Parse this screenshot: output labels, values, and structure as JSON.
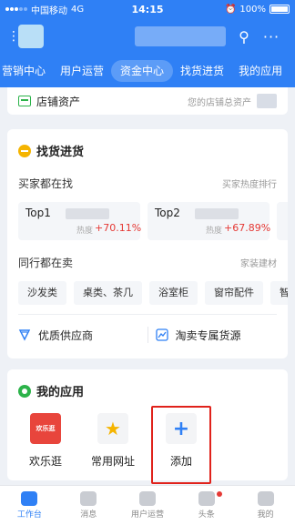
{
  "status_bar": {
    "carrier": "中国移动",
    "network": "4G",
    "time": "14:15",
    "battery": "100%"
  },
  "header": {
    "search_icon": "search-icon",
    "more_icon": "more-icon"
  },
  "nav_tabs": [
    {
      "label": "营销中心",
      "active": false
    },
    {
      "label": "用户运营",
      "active": false
    },
    {
      "label": "资金中心",
      "active": true
    },
    {
      "label": "找货进货",
      "active": false
    },
    {
      "label": "我的应用",
      "active": false
    }
  ],
  "asset_row": {
    "label": "店铺资产",
    "sub": "您的店铺总资产"
  },
  "sourcing": {
    "title": "找货进货",
    "buyers_title": "买家都在找",
    "buyers_link": "买家热度排行",
    "top_items": [
      {
        "rank": "Top1",
        "heat_label": "热度",
        "rate": "+70.11%"
      },
      {
        "rank": "Top2",
        "heat_label": "热度",
        "rate": "+67.89%"
      }
    ],
    "peers_title": "同行都在卖",
    "peers_link": "家装建材",
    "chips": [
      "沙发类",
      "桌类、茶几",
      "浴室柜",
      "窗帘配件",
      "智"
    ],
    "supply_links": [
      "优质供应商",
      "淘卖专属货源"
    ]
  },
  "my_apps": {
    "title": "我的应用",
    "apps": [
      {
        "label": "欢乐逛",
        "tile_text": "欢乐逛"
      },
      {
        "label": "常用网址",
        "tile_text": "★"
      },
      {
        "label": "添加",
        "tile_text": "+"
      }
    ]
  },
  "tab_bar": [
    {
      "label": "工作台",
      "active": true
    },
    {
      "label": "消息",
      "active": false
    },
    {
      "label": "用户运营",
      "active": false
    },
    {
      "label": "头条",
      "active": false
    },
    {
      "label": "我的",
      "active": false
    }
  ],
  "colors": {
    "brand_blue": "#2f80f5",
    "accent_red": "#e53935",
    "highlight_box": "#e0221b"
  }
}
